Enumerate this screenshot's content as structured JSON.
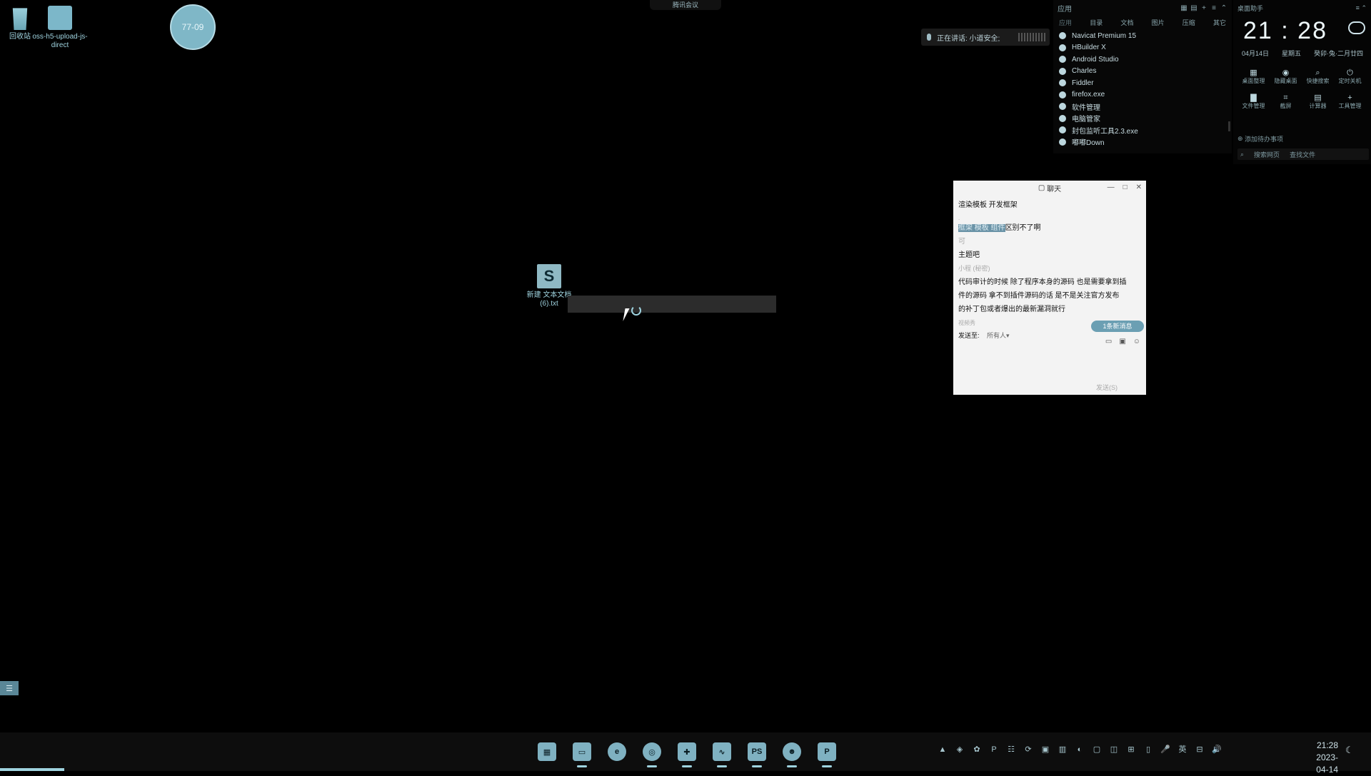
{
  "desktop": {
    "icons": [
      {
        "label": "回收站"
      },
      {
        "label": "oss-h5-upload-js-direct"
      }
    ],
    "file_icon": {
      "label": "新建 文本文档 (6).txt"
    }
  },
  "widget": {
    "label": "77-09"
  },
  "meeting_bar": {
    "label": "腾讯会议"
  },
  "speaking": {
    "text": "正在讲话: 小道安全;"
  },
  "launcher": {
    "title": "应用",
    "tabs": [
      "应用",
      "目录",
      "文档",
      "图片",
      "压缩",
      "其它"
    ],
    "apps": [
      "Navicat Premium 15",
      "HBuilder X",
      "Android Studio",
      "Charles",
      "Fiddler",
      "firefox.exe",
      "软件管理",
      "电脑管家",
      "封包监听工具2.3.exe",
      "嘟嘟Down"
    ]
  },
  "clock_panel": {
    "title": "桌面助手",
    "time": "21 : 28",
    "date": "04月14日",
    "weekday": "星期五",
    "lunar": "癸卯·兔·二月廿四",
    "tools": [
      {
        "icon": "▦",
        "label": "桌面整理"
      },
      {
        "icon": "◉",
        "label": "隐藏桌面"
      },
      {
        "icon": "⌕",
        "label": "快捷搜索"
      },
      {
        "icon": "⏻",
        "label": "定时关机"
      },
      {
        "icon": "▇",
        "label": "文件管理"
      },
      {
        "icon": "⌗",
        "label": "截屏"
      },
      {
        "icon": "▤",
        "label": "计算器"
      },
      {
        "icon": "+",
        "label": "工具管理"
      }
    ],
    "todo": "添加待办事项",
    "search_placeholder": "搜索网页",
    "search_files": "查找文件"
  },
  "chat": {
    "title": "聊天",
    "lines": [
      "渲染模板 开发框架",
      ".",
      "框架  模板  组件",
      "区别不了啊",
      "可",
      "主题吧",
      "小程        (秘密)",
      "代码审计的时候  除了程序本身的源码  也是需要拿到插",
      "件的源码  拿不到插件源码的话  是不是关注官方发布",
      "的补丁包或者爆出的最新漏洞就行"
    ],
    "status": "视频秀",
    "send_to_label": "发送至:",
    "send_to_value": "所有人",
    "new_message": "1条新消息",
    "send_button": "发送(S)"
  },
  "taskbar": {
    "apps": [
      {
        "name": "start",
        "glyph": "▦"
      },
      {
        "name": "file-explorer",
        "glyph": "▭"
      },
      {
        "name": "edge",
        "glyph": "e"
      },
      {
        "name": "chrome",
        "glyph": "◎"
      },
      {
        "name": "tool",
        "glyph": "✚"
      },
      {
        "name": "meeting",
        "glyph": "∿"
      },
      {
        "name": "phpstorm",
        "glyph": "PS"
      },
      {
        "name": "qq",
        "glyph": "☻"
      },
      {
        "name": "p-app",
        "glyph": "P"
      }
    ],
    "tray": [
      "▲",
      "◈",
      "✿",
      "P",
      "☷",
      "⟳",
      "▣",
      "▥",
      "◐",
      "▢",
      "◫",
      "⊞",
      "▯",
      "🎤",
      "英",
      "⊟",
      "🔊"
    ],
    "time": "21:28",
    "date": "2023-04-14"
  }
}
